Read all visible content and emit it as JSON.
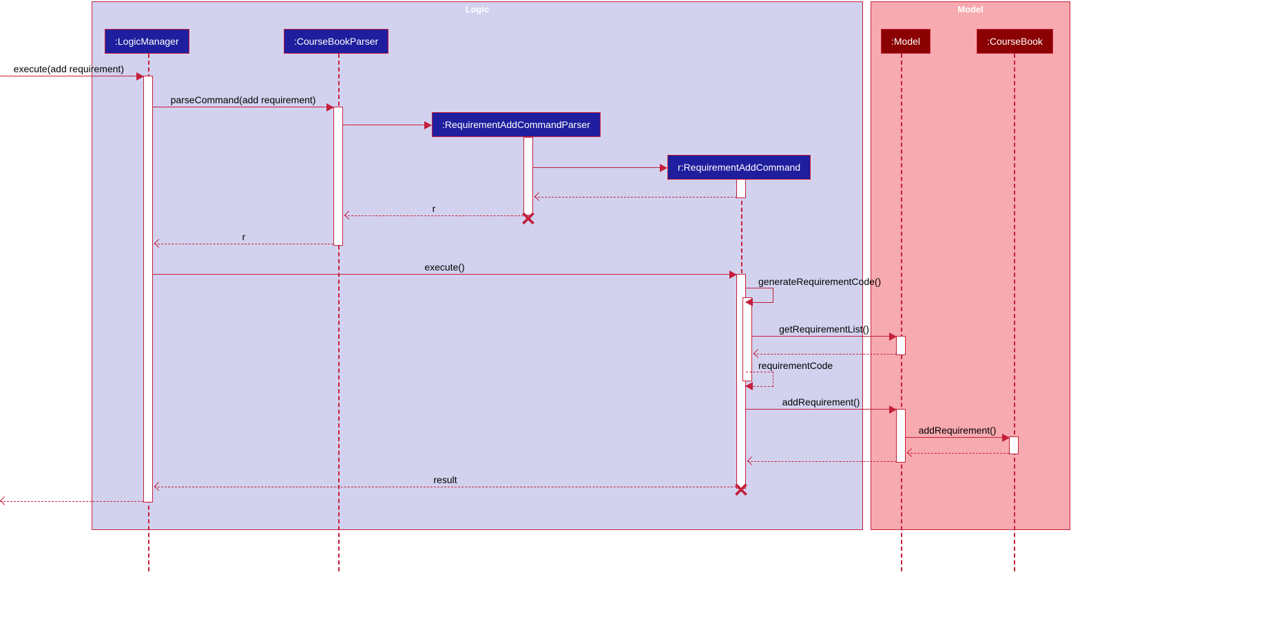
{
  "frames": {
    "logic": "Logic",
    "model": "Model"
  },
  "participants": {
    "logicManager": ":LogicManager",
    "courseBookParser": ":CourseBookParser",
    "reqAddParser": ":RequirementAddCommandParser",
    "reqAddCmd": "r:RequirementAddCommand",
    "model": ":Model",
    "courseBook": ":CourseBook"
  },
  "messages": {
    "execute_add": "execute(add requirement)",
    "parseCommand": "parseCommand(add requirement)",
    "r1": "r",
    "r2": "r",
    "execute": "execute()",
    "generateReqCode": "generateRequirementCode()",
    "getReqList": "getRequirementList()",
    "reqCode": "requirementCode",
    "addReq1": "addRequirement()",
    "addReq2": "addRequirement()",
    "result": "result"
  }
}
